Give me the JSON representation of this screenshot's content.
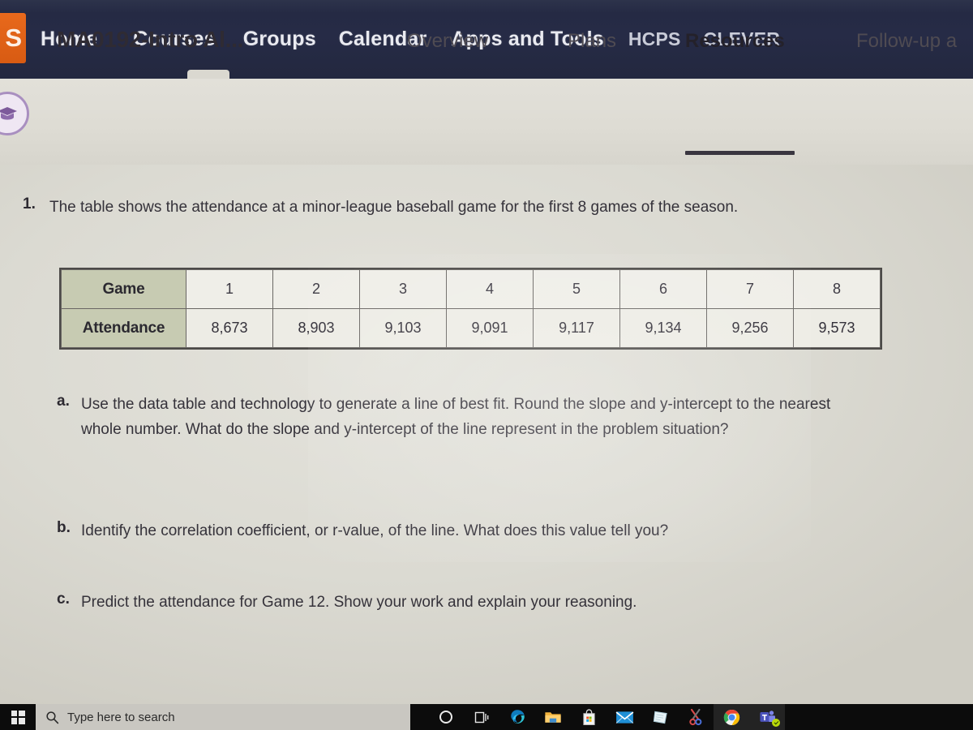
{
  "topnav": {
    "logo_letter": "S",
    "items": [
      {
        "label": "Home",
        "dim": false
      },
      {
        "label": "Courses",
        "dim": false
      },
      {
        "label": "Groups",
        "dim": false
      },
      {
        "label": "Calendar",
        "dim": false
      },
      {
        "label": "Apps and Tools",
        "dim": false
      },
      {
        "label": "HCPS",
        "dim": true
      },
      {
        "label": "CLEVER",
        "dim": true
      }
    ],
    "bg_color": "#242a43",
    "logo_color": "#e8691c"
  },
  "coursebar": {
    "title": "MA0192-Intro Al...",
    "tabs": [
      {
        "label": "Overview",
        "active": false
      },
      {
        "label": "Plans",
        "active": false
      },
      {
        "label": "Resources",
        "active": true
      },
      {
        "label": "Follow-up a",
        "active": false
      }
    ],
    "accent_color": "#3a3640"
  },
  "question": {
    "number": "1.",
    "prompt": "The table shows the attendance at a minor-league baseball game for the first 8 games of the season."
  },
  "chart_data": {
    "type": "table",
    "title": "Attendance at a minor-league baseball game for the first 8 games of the season",
    "row_headers": [
      "Game",
      "Attendance"
    ],
    "categories": [
      "1",
      "2",
      "3",
      "4",
      "5",
      "6",
      "7",
      "8"
    ],
    "values": [
      8673,
      8903,
      9103,
      9091,
      9117,
      9134,
      9256,
      9573
    ],
    "value_labels": [
      "8,673",
      "8,903",
      "9,103",
      "9,091",
      "9,117",
      "9,134",
      "9,256",
      "9,573"
    ],
    "xlabel": "Game",
    "ylabel": "Attendance",
    "header_fill": "#c7cbb2",
    "cell_fill": "#efeee7",
    "border_color": "#4c4a48"
  },
  "parts": [
    {
      "label": "a.",
      "text": "Use the data table and technology to generate a line of best fit. Round the slope and y-intercept to the nearest whole number. What do the slope and y-intercept of the line represent in the problem situation?"
    },
    {
      "label": "b.",
      "text": "Identify the correlation coefficient, or r-value, of the line. What does this value tell you?"
    },
    {
      "label": "c.",
      "text": "Predict the attendance for Game 12. Show your work and explain your reasoning."
    }
  ],
  "taskbar": {
    "search_placeholder": "Type here to search",
    "icons": [
      "cortana-icon",
      "task-view-icon",
      "microsoft-edge-icon",
      "file-explorer-icon",
      "microsoft-store-icon",
      "mail-icon",
      "sticky-notes-icon",
      "snipping-tool-icon",
      "google-chrome-icon",
      "microsoft-teams-icon"
    ],
    "bg_color": "#0c0c0c",
    "search_bg_color": "#c9c7c1"
  }
}
